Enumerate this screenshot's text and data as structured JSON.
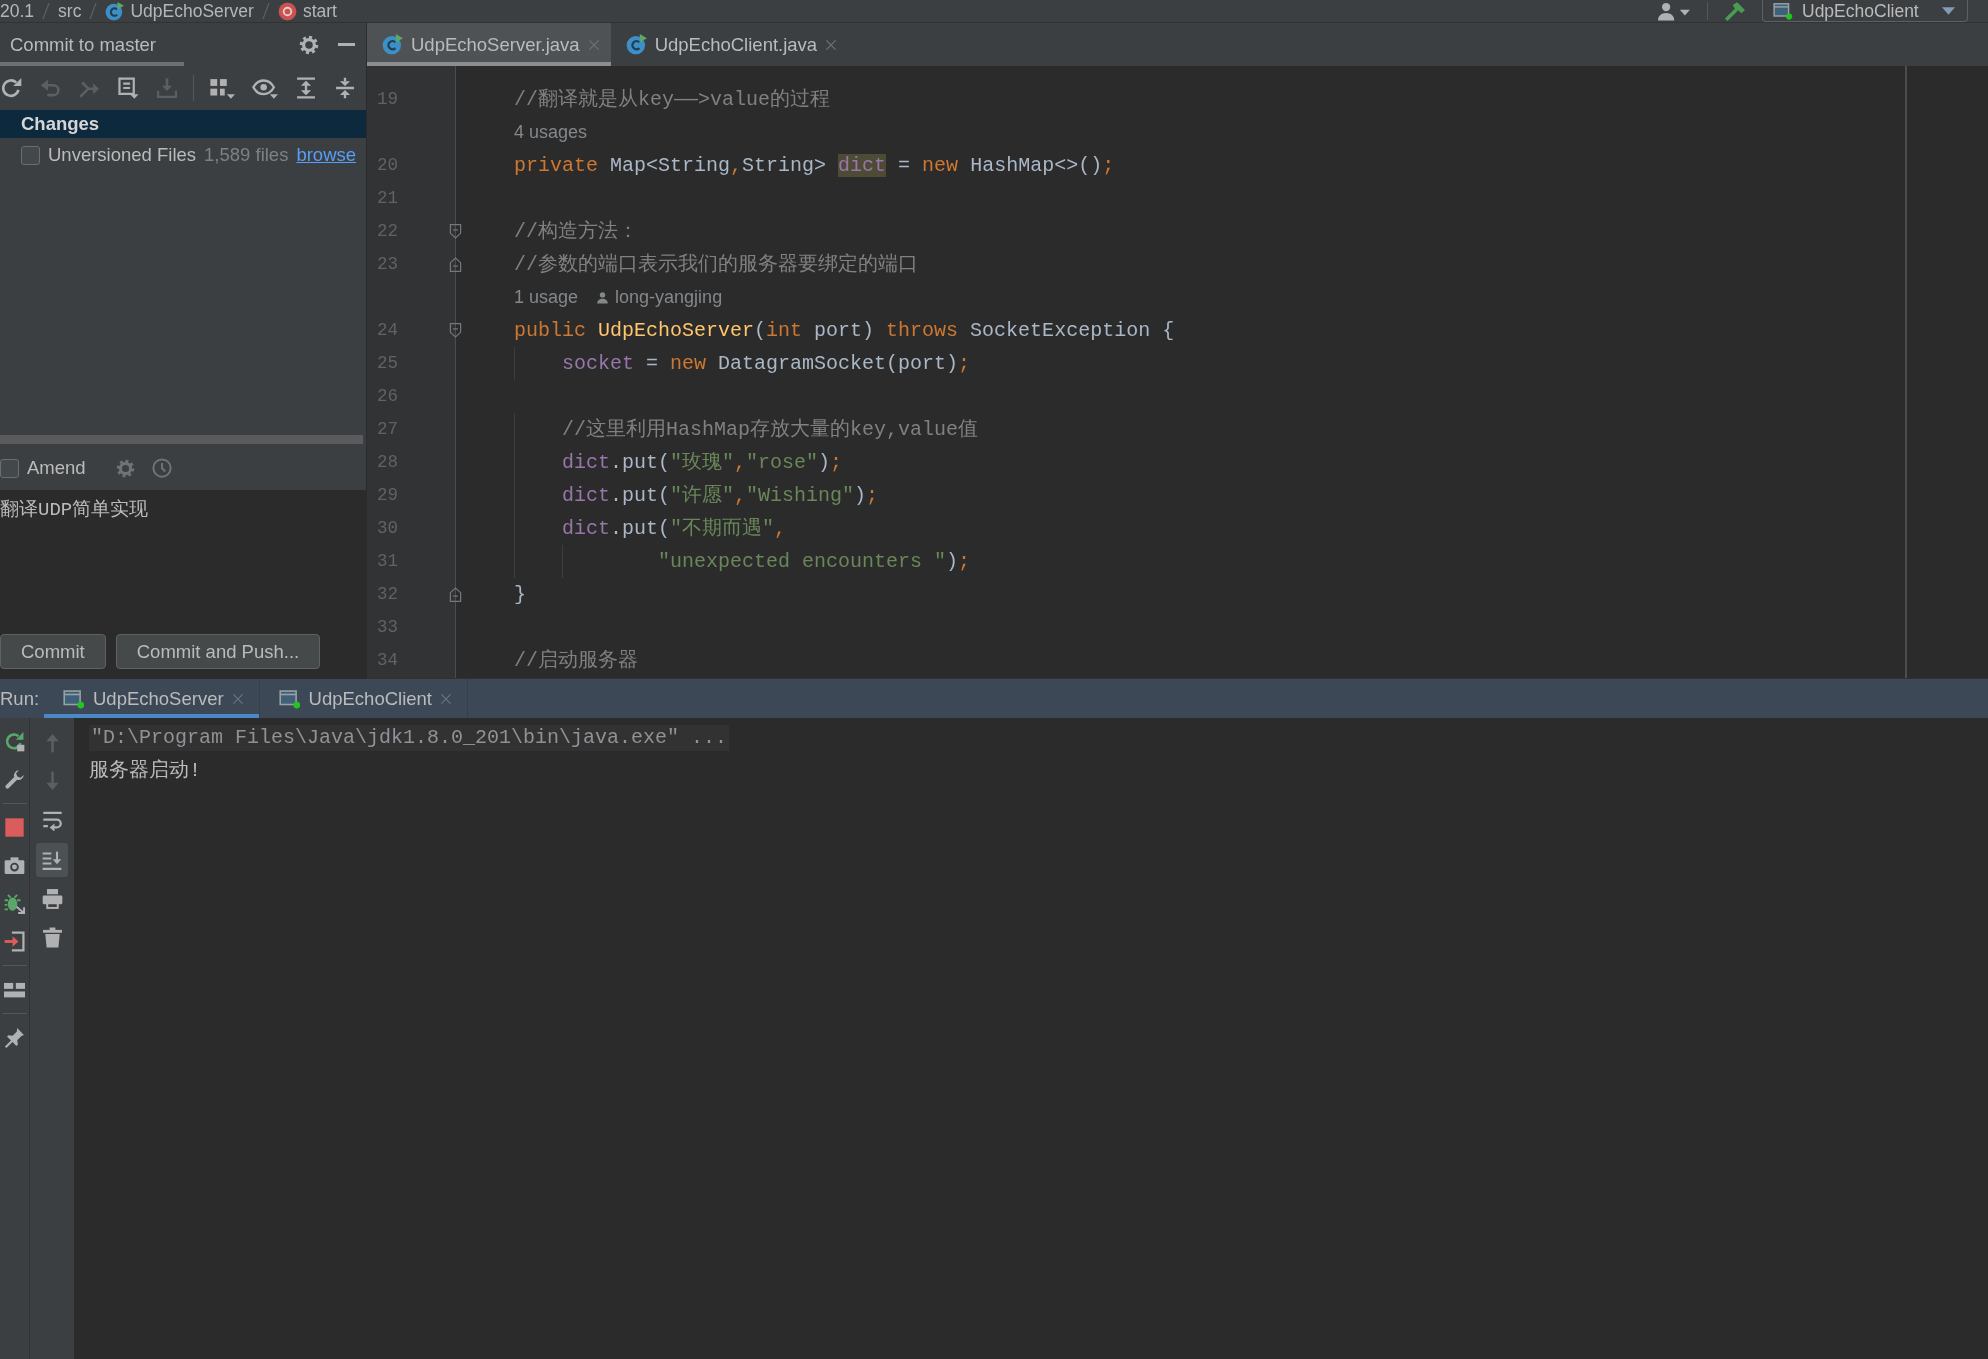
{
  "breadcrumbs": [
    {
      "kind": "text",
      "label": "20.1"
    },
    {
      "kind": "text",
      "label": "src"
    },
    {
      "kind": "class",
      "label": "UdpEchoServer"
    },
    {
      "kind": "method",
      "label": "start"
    }
  ],
  "run_configuration": "UdpEchoClient",
  "commit_panel": {
    "tabs": [
      {
        "label": "Commit to master",
        "selected": true
      }
    ],
    "toolbar": [
      {
        "disabled": false
      },
      {
        "disabled": true
      },
      {
        "disabled": true
      },
      {
        "disabled": false
      },
      {
        "disabled": true
      },
      {
        "disabled": false
      },
      {
        "disabled": false
      },
      {
        "disabled": false
      },
      {
        "disabled": false
      }
    ],
    "tree": [
      {
        "kind": "changelist",
        "label": "Changes",
        "selected": true
      },
      {
        "kind": "unversioned",
        "label": "Unversioned Files",
        "checked": false,
        "count": "1,589 files",
        "link": "browse",
        "selected": false
      }
    ],
    "amend": {
      "label": "Amend",
      "checked": false
    },
    "message": "翻译UDP简单实现",
    "buttons": [
      "Commit",
      "Commit and Push..."
    ]
  },
  "editor": {
    "tabs": [
      {
        "label": "UdpEchoServer.java",
        "selected": true
      },
      {
        "label": "UdpEchoClient.java",
        "selected": false
      }
    ],
    "lines": [
      {
        "kind": "code",
        "number": "19",
        "fold_start": false,
        "fold_end": false,
        "tokens": [
          {
            "kind": "comment",
            "text": "    //翻译就是从key——>value的过程"
          }
        ]
      },
      {
        "kind": "hint",
        "usages": "4 usages"
      },
      {
        "kind": "code",
        "number": "20",
        "fold_start": false,
        "fold_end": false,
        "tokens": [
          {
            "kind": "keyword",
            "text": "    private"
          },
          {
            "kind": "plain",
            "text": " Map<String"
          },
          {
            "kind": "keyword",
            "text": ","
          },
          {
            "kind": "plain",
            "text": "String> "
          },
          {
            "kind": "highlight",
            "text": "dict"
          },
          {
            "kind": "plain",
            "text": " = "
          },
          {
            "kind": "keyword",
            "text": "new"
          },
          {
            "kind": "plain",
            "text": " HashMap<>()"
          },
          {
            "kind": "keyword",
            "text": ";"
          }
        ]
      },
      {
        "kind": "code",
        "number": "21",
        "fold_start": false,
        "fold_end": false
      },
      {
        "kind": "code",
        "number": "22",
        "fold_start": true,
        "fold_end": false,
        "tokens": [
          {
            "kind": "comment",
            "text": "    //构造方法："
          }
        ]
      },
      {
        "kind": "code",
        "number": "23",
        "fold_start": false,
        "fold_end": true,
        "tokens": [
          {
            "kind": "comment",
            "text": "    //参数的端口表示我们的服务器要绑定的端口"
          }
        ]
      },
      {
        "kind": "hint",
        "usages": "1 usage",
        "author": "long-yangjing"
      },
      {
        "kind": "code",
        "number": "24",
        "fold_start": true,
        "fold_end": false,
        "tokens": [
          {
            "kind": "keyword",
            "text": "    public "
          },
          {
            "kind": "method",
            "text": "UdpEchoServer"
          },
          {
            "kind": "plain",
            "text": "("
          },
          {
            "kind": "keyword",
            "text": "int"
          },
          {
            "kind": "plain",
            "text": " port) "
          },
          {
            "kind": "keyword",
            "text": "throws"
          },
          {
            "kind": "plain",
            "text": " SocketException {"
          }
        ]
      },
      {
        "kind": "code",
        "number": "25",
        "fold_start": false,
        "fold_end": false,
        "tokens": [
          {
            "kind": "field",
            "text": "        socket"
          },
          {
            "kind": "plain",
            "text": " = "
          },
          {
            "kind": "keyword",
            "text": "new"
          },
          {
            "kind": "plain",
            "text": " DatagramSocket(port)"
          },
          {
            "kind": "keyword",
            "text": ";"
          }
        ]
      },
      {
        "kind": "code",
        "number": "26",
        "fold_start": false,
        "fold_end": false
      },
      {
        "kind": "code",
        "number": "27",
        "fold_start": false,
        "fold_end": false,
        "tokens": [
          {
            "kind": "comment",
            "text": "        //这里利用HashMap存放大量的key,value值"
          }
        ]
      },
      {
        "kind": "code",
        "number": "28",
        "fold_start": false,
        "fold_end": false,
        "tokens": [
          {
            "kind": "field",
            "text": "        dict"
          },
          {
            "kind": "plain",
            "text": ".put("
          },
          {
            "kind": "string",
            "text": "\"玫瑰\""
          },
          {
            "kind": "keyword",
            "text": ","
          },
          {
            "kind": "string",
            "text": "\"rose\""
          },
          {
            "kind": "plain",
            "text": ")"
          },
          {
            "kind": "keyword",
            "text": ";"
          }
        ]
      },
      {
        "kind": "code",
        "number": "29",
        "fold_start": false,
        "fold_end": false,
        "tokens": [
          {
            "kind": "field",
            "text": "        dict"
          },
          {
            "kind": "plain",
            "text": ".put("
          },
          {
            "kind": "string",
            "text": "\"许愿\""
          },
          {
            "kind": "keyword",
            "text": ","
          },
          {
            "kind": "string",
            "text": "\"Wishing\""
          },
          {
            "kind": "plain",
            "text": ")"
          },
          {
            "kind": "keyword",
            "text": ";"
          }
        ]
      },
      {
        "kind": "code",
        "number": "30",
        "fold_start": false,
        "fold_end": false,
        "tokens": [
          {
            "kind": "field",
            "text": "        dict"
          },
          {
            "kind": "plain",
            "text": ".put("
          },
          {
            "kind": "string",
            "text": "\"不期而遇\""
          },
          {
            "kind": "keyword",
            "text": ","
          }
        ]
      },
      {
        "kind": "code",
        "number": "31",
        "fold_start": false,
        "fold_end": false,
        "tokens": [
          {
            "kind": "string",
            "text": "                \"unexpected encounters \""
          },
          {
            "kind": "plain",
            "text": ")"
          },
          {
            "kind": "keyword",
            "text": ";"
          }
        ]
      },
      {
        "kind": "code",
        "number": "32",
        "fold_start": false,
        "fold_end": true,
        "tokens": [
          {
            "kind": "plain",
            "text": "    }"
          }
        ]
      },
      {
        "kind": "code",
        "number": "33",
        "fold_start": false,
        "fold_end": false
      },
      {
        "kind": "code",
        "number": "34",
        "fold_start": false,
        "fold_end": false,
        "tokens": [
          {
            "kind": "comment",
            "text": "    //启动服务器"
          }
        ]
      }
    ]
  },
  "run": {
    "label": "Run:",
    "tabs": [
      {
        "label": "UdpEchoServer",
        "selected": true
      },
      {
        "label": "UdpEchoClient",
        "selected": false
      }
    ],
    "console_tools": [
      {
        "disabled": true,
        "on": false
      },
      {
        "disabled": true,
        "on": false
      },
      {
        "disabled": false,
        "on": false
      },
      {
        "disabled": false,
        "on": true
      },
      {
        "disabled": false,
        "on": false
      },
      {
        "disabled": false,
        "on": false
      }
    ],
    "console": [
      {
        "kind": "command",
        "text": "\"D:\\Program Files\\Java\\jdk1.8.0_201\\bin\\java.exe\" ..."
      },
      {
        "kind": "output",
        "text": "服务器启动!"
      }
    ]
  }
}
